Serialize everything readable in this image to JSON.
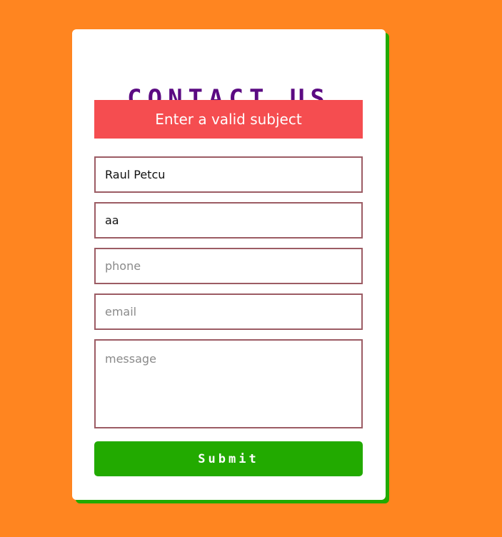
{
  "form": {
    "title": "CONTACT US",
    "error_message": "Enter a valid subject",
    "fields": {
      "name": {
        "value": "Raul Petcu",
        "placeholder": ""
      },
      "subject": {
        "value": "aa",
        "placeholder": ""
      },
      "phone": {
        "value": "",
        "placeholder": "phone"
      },
      "email": {
        "value": "",
        "placeholder": "email"
      },
      "message": {
        "value": "",
        "placeholder": "message"
      }
    },
    "submit_label": "Submit"
  },
  "colors": {
    "background": "#ff8520",
    "title": "#5b0a82",
    "error_bg": "#f54d50",
    "accent_green": "#22aa00",
    "field_border": "#9c5c64"
  }
}
